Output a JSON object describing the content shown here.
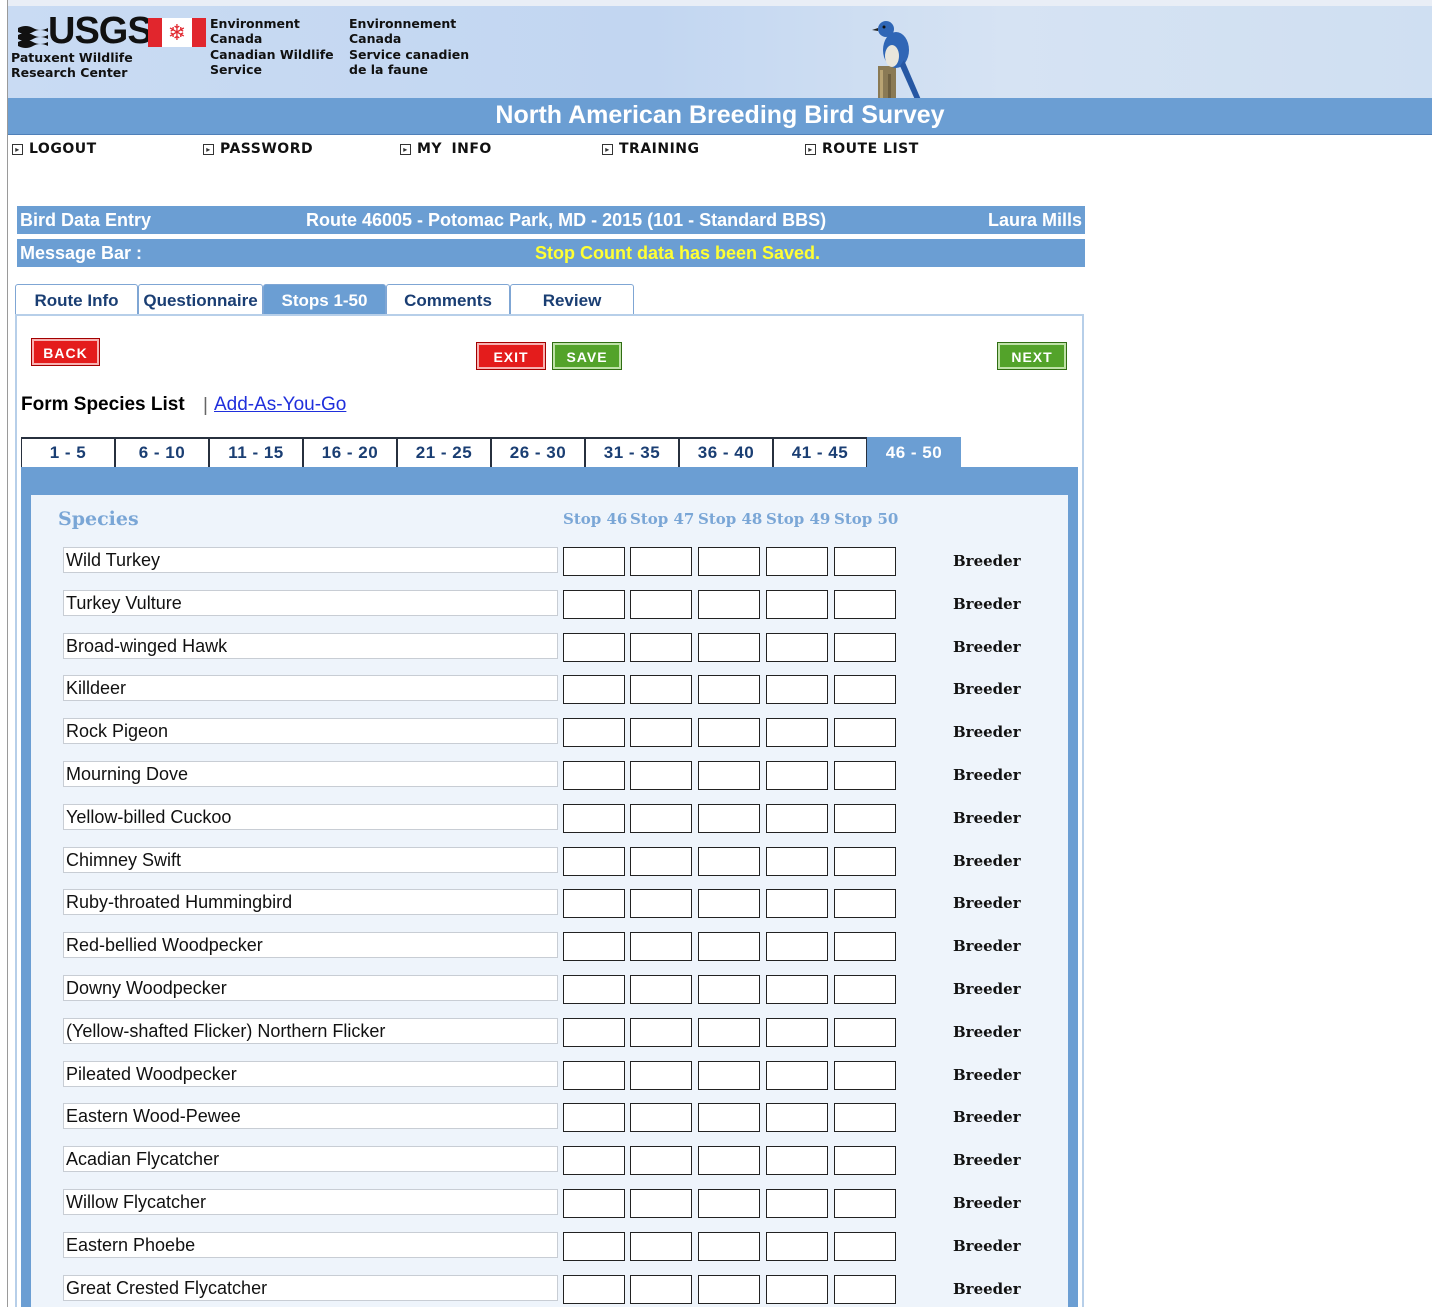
{
  "header": {
    "usgs": "USGS",
    "usgs_line1": "Patuxent Wildlife",
    "usgs_line2": "Research Center",
    "env_en_1": "Environment",
    "env_en_2": "Canada",
    "env_en_3": "Canadian Wildlife",
    "env_en_4": "Service",
    "env_fr_1": "Environnement",
    "env_fr_2": "Canada",
    "env_fr_3": "Service canadien",
    "env_fr_4": "de la faune",
    "site_title": "North American Breeding Bird Survey"
  },
  "nav": [
    "LOGOUT",
    "PASSWORD",
    "MY INFO",
    "TRAINING",
    "ROUTE LIST"
  ],
  "data_header": {
    "left": "Bird Data Entry",
    "center": "Route 46005 - Potomac Park, MD - 2015 (101 - Standard BBS)",
    "user": "Laura Mills"
  },
  "message_bar": {
    "label": "Message Bar :",
    "message": "Stop Count data has been Saved."
  },
  "tabs": [
    "Route Info",
    "Questionnaire",
    "Stops 1-50",
    "Comments",
    "Review"
  ],
  "active_tab": "Stops 1-50",
  "buttons": {
    "back": "BACK",
    "exit": "EXIT",
    "save": "SAVE",
    "next": "NEXT"
  },
  "form": {
    "label": "Form Species List",
    "separator": "|",
    "link": "Add-As-You-Go"
  },
  "range_tabs": [
    "1 - 5",
    "6 - 10",
    "11 - 15",
    "16 - 20",
    "21 - 25",
    "26 - 30",
    "31 - 35",
    "36 - 40",
    "41 - 45",
    "46 - 50"
  ],
  "active_range": "46 - 50",
  "grid": {
    "species_header": "Species",
    "stop_headers": [
      "Stop 46",
      "Stop 47",
      "Stop 48",
      "Stop 49",
      "Stop 50"
    ],
    "breeder_label": "Breeder",
    "species": [
      "Wild Turkey",
      "Turkey Vulture",
      "Broad-winged Hawk",
      "Killdeer",
      "Rock Pigeon",
      "Mourning Dove",
      "Yellow-billed Cuckoo",
      "Chimney Swift",
      "Ruby-throated Hummingbird",
      "Red-bellied Woodpecker",
      "Downy Woodpecker",
      "(Yellow-shafted Flicker) Northern Flicker",
      "Pileated Woodpecker",
      "Eastern Wood-Pewee",
      "Acadian Flycatcher",
      "Willow Flycatcher",
      "Eastern Phoebe",
      "Great Crested Flycatcher"
    ]
  },
  "colors": {
    "accent_blue": "#6b9ed3",
    "message_yellow": "#ffff33",
    "back_red": "#e41c1c",
    "save_green": "#53a32a"
  }
}
